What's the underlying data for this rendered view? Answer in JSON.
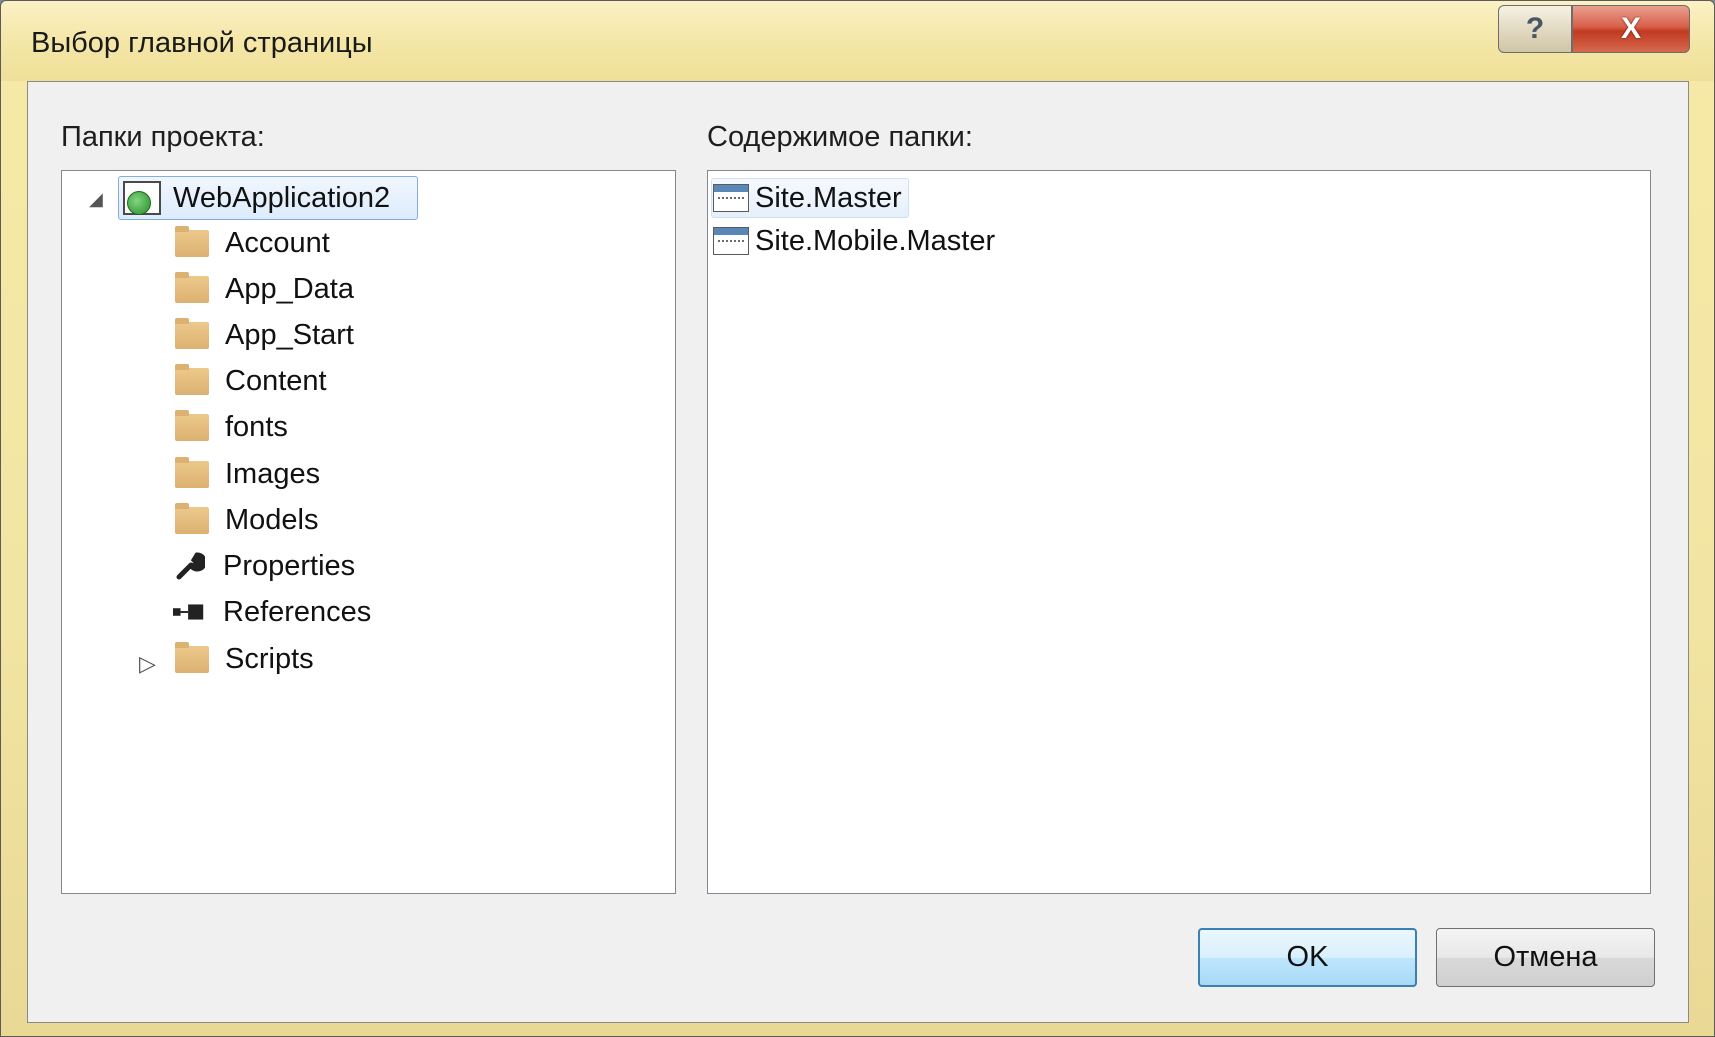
{
  "window": {
    "title": "Выбор главной страницы",
    "help_glyph": "?",
    "close_glyph": "X"
  },
  "left_panel": {
    "label": "Папки проекта:",
    "root": {
      "label": "WebApplication2",
      "icon": "web-project-icon",
      "expanded": true,
      "selected": true
    },
    "items": [
      {
        "label": "Account",
        "icon": "folder-icon"
      },
      {
        "label": "App_Data",
        "icon": "folder-icon"
      },
      {
        "label": "App_Start",
        "icon": "folder-icon"
      },
      {
        "label": "Content",
        "icon": "folder-icon"
      },
      {
        "label": "fonts",
        "icon": "folder-icon"
      },
      {
        "label": "Images",
        "icon": "folder-icon"
      },
      {
        "label": "Models",
        "icon": "folder-icon"
      },
      {
        "label": "Properties",
        "icon": "wrench-icon"
      },
      {
        "label": "References",
        "icon": "references-icon"
      },
      {
        "label": "Scripts",
        "icon": "folder-icon",
        "has_children": true
      }
    ]
  },
  "right_panel": {
    "label": "Содержимое папки:",
    "files": [
      {
        "label": "Site.Master",
        "icon": "master-page-icon",
        "selected": true
      },
      {
        "label": "Site.Mobile.Master",
        "icon": "master-page-icon"
      }
    ]
  },
  "buttons": {
    "ok_label": "OK",
    "cancel_label": "Отмена"
  },
  "colors": {
    "title_bar": "#f4e6a6",
    "selection_border": "#84acdd",
    "folder": "#dcb171",
    "close_button": "#c23a22"
  }
}
